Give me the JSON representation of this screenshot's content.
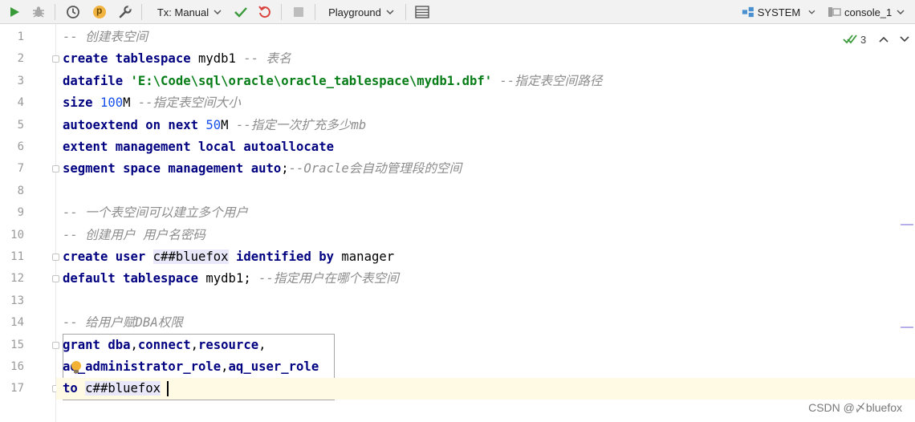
{
  "toolbar": {
    "tx_mode": "Tx: Manual",
    "playground": "Playground",
    "schema": "SYSTEM",
    "console": "console_1",
    "p_badge": "p"
  },
  "inspections": {
    "count": "3"
  },
  "icons": {
    "run": "run-icon",
    "debug": "debug-icon",
    "history": "history-icon",
    "settings": "wrench-icon",
    "commit": "check-icon",
    "rollback": "rollback-icon",
    "stop": "stop-icon",
    "results": "table-icon",
    "bulb": "lightbulb-icon"
  },
  "editor": {
    "lines": [
      {
        "n": "1",
        "tokens": [
          {
            "t": "cmt",
            "v": "-- 创建表空间"
          }
        ]
      },
      {
        "n": "2",
        "tokens": [
          {
            "t": "kw",
            "v": "create tablespace"
          },
          {
            "t": "",
            "v": " mydb1 "
          },
          {
            "t": "cmt",
            "v": "-- 表名"
          }
        ]
      },
      {
        "n": "3",
        "tokens": [
          {
            "t": "kw",
            "v": "datafile"
          },
          {
            "t": "",
            "v": " "
          },
          {
            "t": "str",
            "v": "'E:\\Code\\sql\\oracle\\oracle_tablespace\\mydb1.dbf'"
          },
          {
            "t": "",
            "v": " "
          },
          {
            "t": "cmt",
            "v": "--指定表空间路径"
          }
        ]
      },
      {
        "n": "4",
        "tokens": [
          {
            "t": "kw",
            "v": "size"
          },
          {
            "t": "",
            "v": " "
          },
          {
            "t": "num",
            "v": "100"
          },
          {
            "t": "",
            "v": "M "
          },
          {
            "t": "cmt",
            "v": "--指定表空间大小"
          }
        ]
      },
      {
        "n": "5",
        "tokens": [
          {
            "t": "kw",
            "v": "autoextend on next"
          },
          {
            "t": "",
            "v": " "
          },
          {
            "t": "num",
            "v": "50"
          },
          {
            "t": "",
            "v": "M "
          },
          {
            "t": "cmt",
            "v": "--指定一次扩充多少mb"
          }
        ]
      },
      {
        "n": "6",
        "tokens": [
          {
            "t": "kw",
            "v": "extent management local autoallocate"
          }
        ]
      },
      {
        "n": "7",
        "tokens": [
          {
            "t": "kw",
            "v": "segment space management auto"
          },
          {
            "t": "",
            "v": ";"
          },
          {
            "t": "cmt",
            "v": "--Oracle会自动管理段的空间"
          }
        ]
      },
      {
        "n": "8",
        "tokens": []
      },
      {
        "n": "9",
        "tokens": [
          {
            "t": "cmt",
            "v": "-- 一个表空间可以建立多个用户"
          }
        ]
      },
      {
        "n": "10",
        "tokens": [
          {
            "t": "cmt",
            "v": "-- 创建用户 用户名密码"
          }
        ]
      },
      {
        "n": "11",
        "tokens": [
          {
            "t": "kw",
            "v": "create user"
          },
          {
            "t": "",
            "v": " "
          },
          {
            "t": "hl",
            "v": "c##bluefox"
          },
          {
            "t": "",
            "v": " "
          },
          {
            "t": "kw",
            "v": "identified by"
          },
          {
            "t": "",
            "v": " manager"
          }
        ]
      },
      {
        "n": "12",
        "tokens": [
          {
            "t": "kw",
            "v": "default tablespace"
          },
          {
            "t": "",
            "v": " mydb1; "
          },
          {
            "t": "cmt",
            "v": "--指定用户在哪个表空间"
          }
        ]
      },
      {
        "n": "13",
        "tokens": []
      },
      {
        "n": "14",
        "tokens": [
          {
            "t": "cmt",
            "v": "-- 给用户赋DBA权限"
          }
        ]
      },
      {
        "n": "15",
        "tokens": [
          {
            "t": "kw",
            "v": "grant dba"
          },
          {
            "t": "",
            "v": ","
          },
          {
            "t": "kw",
            "v": "connect"
          },
          {
            "t": "",
            "v": ","
          },
          {
            "t": "kw",
            "v": "resource"
          },
          {
            "t": "",
            "v": ","
          }
        ]
      },
      {
        "n": "16",
        "tokens": [
          {
            "t": "kw",
            "v": "aq_administrator_role"
          },
          {
            "t": "",
            "v": ","
          },
          {
            "t": "kw",
            "v": "aq_user_role"
          }
        ]
      },
      {
        "n": "17",
        "tokens": [
          {
            "t": "kw",
            "v": "to"
          },
          {
            "t": "",
            "v": " "
          },
          {
            "t": "hl",
            "v": "c##bluefox"
          }
        ]
      }
    ],
    "current_line": "17"
  },
  "watermark": "CSDN @〆bluefox"
}
